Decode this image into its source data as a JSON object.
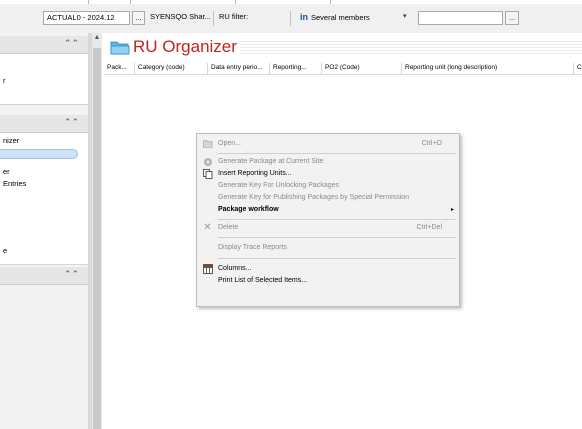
{
  "toolbar": {
    "period": "ACTUAL0 - 2024.12",
    "ellipsis_1": "...",
    "entity_filter": "SYENSQO Shar...",
    "ru_filter_label": "RU filter:",
    "members_icon": "in",
    "members_value": "Several members",
    "dropdown_arrow": "▾",
    "filter_value": "",
    "ellipsis_2": "..."
  },
  "sidebar": {
    "sections": [
      {
        "chevron": "⌃⌃",
        "items": [
          "r"
        ]
      },
      {
        "chevron": "⌃⌃",
        "items": [
          "nizer",
          "",
          "er",
          "Entries",
          "e"
        ]
      },
      {
        "chevron": "⌃⌃",
        "items": []
      }
    ]
  },
  "main": {
    "title": "RU Organizer",
    "folder_icon": "folder-icon",
    "columns": [
      "Pack...",
      "Category (code)",
      "Data entry perio...",
      "Reporting...",
      "PO2 (Code)",
      "Reporting unit (long description)",
      "C"
    ]
  },
  "context_menu": {
    "items": [
      {
        "label": "Open...",
        "shortcut": "Ctrl+O",
        "icon": "open-folder-icon",
        "disabled": true
      },
      {
        "separator": true
      },
      {
        "label": "Generate Package at Current Site",
        "icon": "generate-icon",
        "disabled": true
      },
      {
        "label": "Insert Reporting Units...",
        "icon": "insert-icon",
        "disabled": false
      },
      {
        "label": "Generate Key For Unlocking Packages",
        "disabled": true
      },
      {
        "label": "Generate Key for Publishing Packages by Special Permission",
        "disabled": true
      },
      {
        "label": "Package workflow",
        "submenu": "▸",
        "bold": true
      },
      {
        "separator": true
      },
      {
        "label": "Delete",
        "shortcut": "Ctrl+Del",
        "icon": "delete-icon",
        "disabled": true
      },
      {
        "separator": true
      },
      {
        "label": "Display Trace Reports",
        "disabled": true
      },
      {
        "separator": true
      },
      {
        "label": "Columns...",
        "icon": "columns-icon",
        "disabled": false
      },
      {
        "label": "Print List of Selected Items...",
        "disabled": false
      }
    ]
  }
}
